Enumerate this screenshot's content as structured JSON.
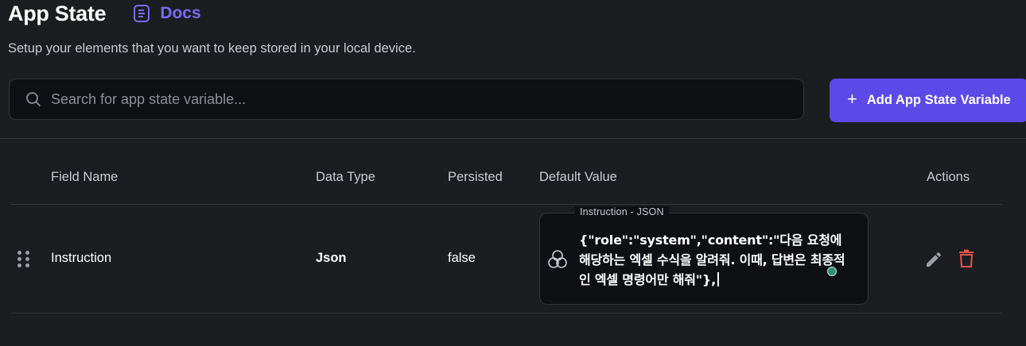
{
  "header": {
    "title": "App State",
    "docs_label": "Docs"
  },
  "subtitle": "Setup your elements that you want to keep stored in your local device.",
  "search": {
    "placeholder": "Search for app state variable...",
    "value": ""
  },
  "add_button": {
    "label": "Add App State Variable"
  },
  "table": {
    "columns": [
      "Field Name",
      "Data Type",
      "Persisted",
      "Default Value",
      "Actions"
    ],
    "rows": [
      {
        "field_name": "Instruction",
        "data_type": "Json",
        "persisted": "false",
        "default_value": {
          "label": "Instruction - JSON",
          "text": "{\"role\":\"system\",\"content\":\"다음 요청에 해당하는 엑셀 수식을 알려줘. 이때, 답변은 최종적인 엑셀 명령어만 해줘\"},"
        }
      }
    ]
  },
  "colors": {
    "accent": "#5c49e8",
    "docs": "#7a6bf5",
    "delete": "#e0554f",
    "background": "#1b1d20"
  },
  "icons": [
    "document-icon",
    "search-icon",
    "plus-icon",
    "drag-handle-icon",
    "json-icon",
    "edit-icon",
    "delete-icon"
  ]
}
